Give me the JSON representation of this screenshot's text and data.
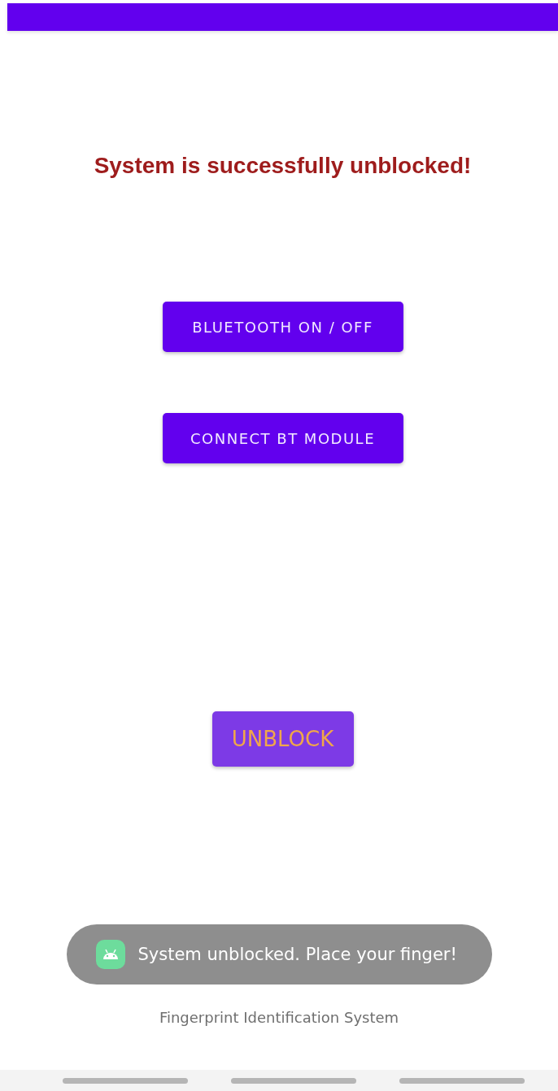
{
  "status_message": "System is successfully unblocked!",
  "buttons": [
    {
      "label": "BLUETOOTH ON / OFF",
      "kind": "primary"
    },
    {
      "label": "CONNECT BT MODULE",
      "kind": "primary"
    },
    {
      "label": "UNBLOCK",
      "kind": "accent"
    }
  ],
  "toast": {
    "text": "System unblocked. Place your finger!"
  },
  "footer": "Fingerprint Identification System"
}
